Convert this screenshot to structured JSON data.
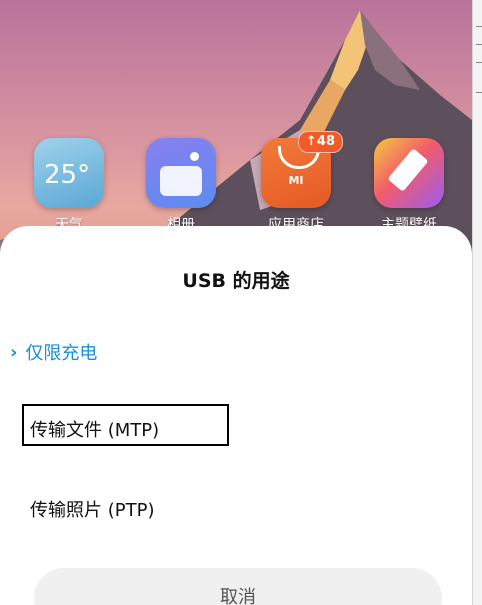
{
  "wallpaper": {
    "description_colors": {
      "sky": "#d28da0",
      "mountain": "#6b5a64"
    }
  },
  "home_apps": [
    {
      "label": "天气",
      "icon": "weather-icon",
      "icon_text": "25°"
    },
    {
      "label": "相册",
      "icon": "gallery-icon"
    },
    {
      "label": "应用商店",
      "icon": "app-store-icon",
      "icon_text": "MI",
      "badge": "↑48"
    },
    {
      "label": "主题壁纸",
      "icon": "theme-brush-icon"
    }
  ],
  "dialog": {
    "title": "USB 的用途",
    "options": [
      {
        "label": "仅限充电",
        "selected": true,
        "chevron": "›"
      },
      {
        "label": "传输文件 (MTP)",
        "selected": false
      },
      {
        "label": "传输照片 (PTP)",
        "selected": false
      }
    ],
    "cancel_label": "取消"
  },
  "colors": {
    "accent": "#1b8fd6",
    "store_badge": "#f25a2a",
    "sheet_bg": "#ffffff",
    "cancel_bg": "#f0f0f0"
  }
}
